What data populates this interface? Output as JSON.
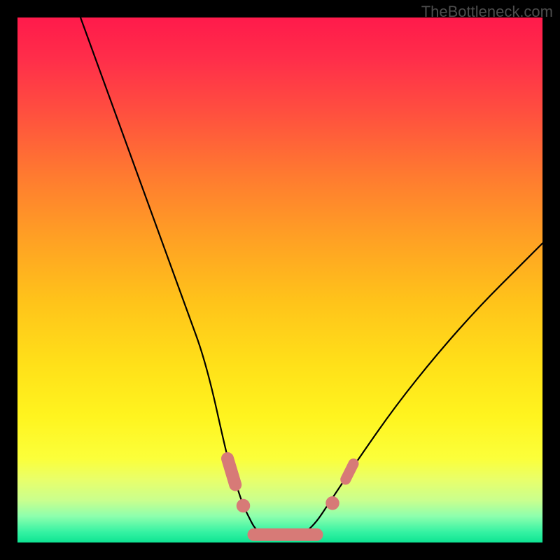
{
  "watermark": "TheBottleneck.com",
  "chart_data": {
    "type": "line",
    "title": "",
    "xlabel": "",
    "ylabel": "",
    "xlim": [
      0,
      100
    ],
    "ylim": [
      0,
      100
    ],
    "grid": false,
    "legend": false,
    "series": [
      {
        "name": "bottleneck-curve",
        "color": "#000000",
        "x": [
          12,
          16,
          20,
          24,
          28,
          32,
          36,
          40,
          41,
          42,
          43,
          44,
          45,
          46,
          47,
          48,
          49,
          51,
          53,
          55,
          57,
          59,
          61,
          65,
          72,
          80,
          88,
          96,
          100
        ],
        "y": [
          100,
          89,
          78,
          67,
          56,
          45,
          34,
          16,
          13,
          10,
          7,
          5,
          3,
          2,
          1,
          1,
          1,
          1,
          1,
          2,
          4,
          7,
          10,
          16,
          26,
          36,
          45,
          53,
          57
        ]
      }
    ],
    "markers": [
      {
        "name": "highlight-segment-left",
        "shape": "capsule",
        "color": "#d77a77",
        "x1": 40.0,
        "y1": 16.0,
        "x2": 41.5,
        "y2": 11.0,
        "width": 2.4
      },
      {
        "name": "highlight-dot-left",
        "shape": "circle",
        "color": "#d77a77",
        "cx": 43.0,
        "cy": 7.0,
        "r": 1.3
      },
      {
        "name": "highlight-segment-bottom",
        "shape": "capsule",
        "color": "#d77a77",
        "x1": 45.0,
        "y1": 1.5,
        "x2": 57.0,
        "y2": 1.5,
        "width": 2.4
      },
      {
        "name": "highlight-dot-right",
        "shape": "circle",
        "color": "#d77a77",
        "cx": 60.0,
        "cy": 7.5,
        "r": 1.3
      },
      {
        "name": "highlight-segment-right",
        "shape": "capsule",
        "color": "#d77a77",
        "x1": 62.5,
        "y1": 12.0,
        "x2": 64.0,
        "y2": 15.0,
        "width": 2.0
      }
    ]
  }
}
